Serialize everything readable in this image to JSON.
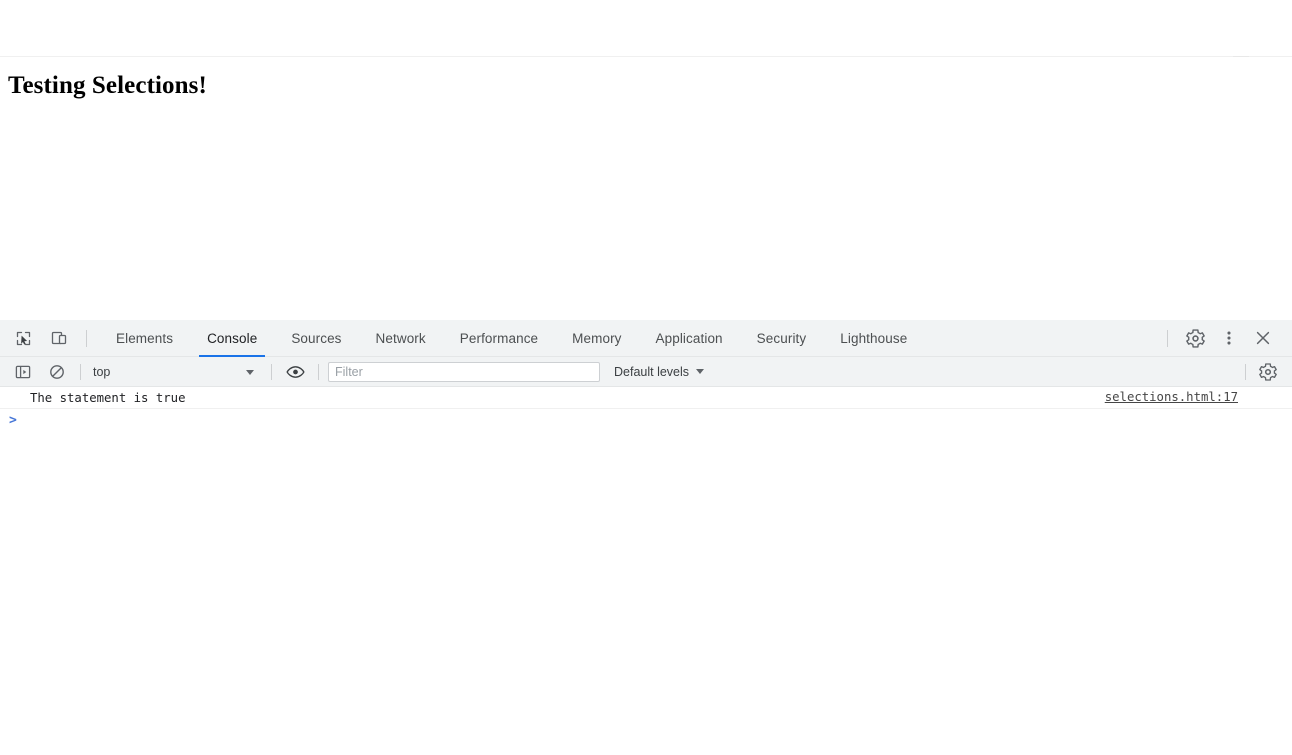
{
  "page": {
    "heading": "Testing Selections!"
  },
  "devtools": {
    "toolbar": {
      "inspect_icon": "inspect-cursor-icon",
      "device_toggle_icon": "device-toolbar-icon",
      "settings_icon": "gear-icon",
      "more_icon": "kebab-menu-icon",
      "close_icon": "close-icon"
    },
    "tabs": [
      {
        "label": "Elements",
        "active": false
      },
      {
        "label": "Console",
        "active": true
      },
      {
        "label": "Sources",
        "active": false
      },
      {
        "label": "Network",
        "active": false
      },
      {
        "label": "Performance",
        "active": false
      },
      {
        "label": "Memory",
        "active": false
      },
      {
        "label": "Application",
        "active": false
      },
      {
        "label": "Security",
        "active": false
      },
      {
        "label": "Lighthouse",
        "active": false
      }
    ],
    "console_toolbar": {
      "sidebar_icon": "console-sidebar-icon",
      "clear_icon": "clear-console-icon",
      "context_value": "top",
      "eye_icon": "eye-icon",
      "filter_placeholder": "Filter",
      "filter_value": "",
      "levels_label": "Default levels",
      "settings_icon": "gear-icon"
    },
    "console_output": [
      {
        "message": "The statement is true",
        "source": "selections.html:17"
      }
    ],
    "prompt": {
      "caret": ">",
      "value": ""
    }
  },
  "colors": {
    "accent": "#1a73e8",
    "toolbar_bg": "#f1f3f4",
    "prompt_caret": "#4676d7",
    "text": "#202124"
  }
}
